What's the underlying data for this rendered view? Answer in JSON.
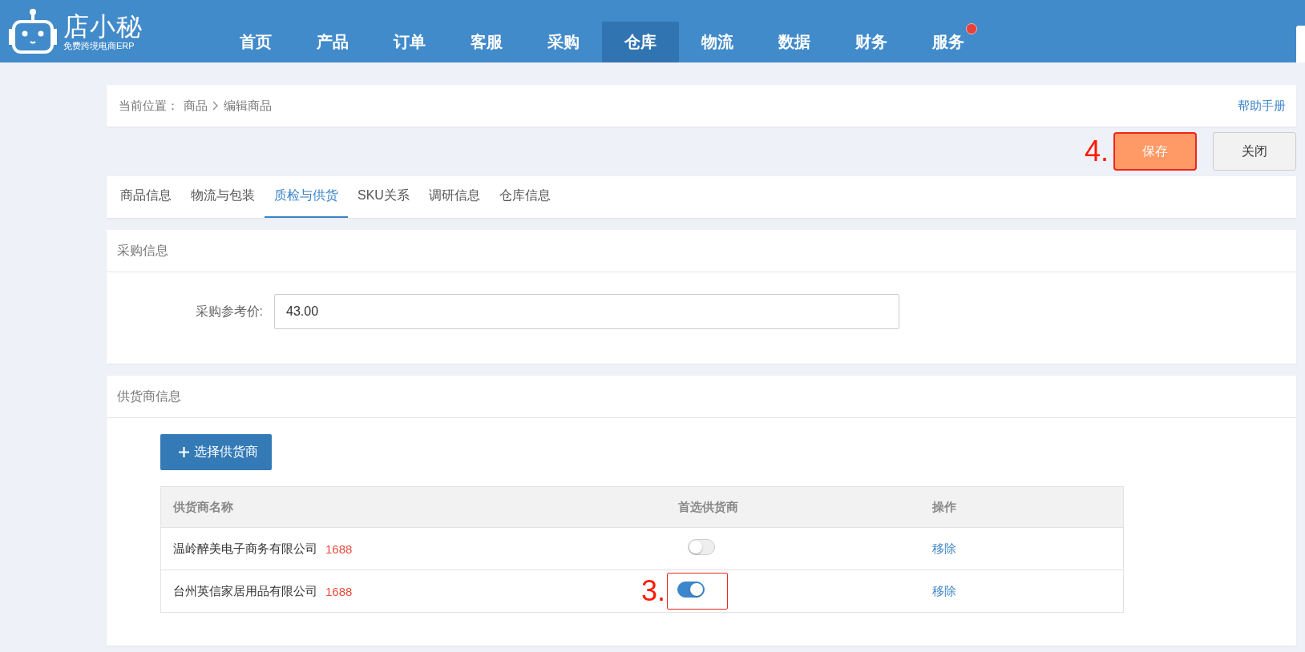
{
  "header": {
    "logo": {
      "name": "店小秘",
      "tagline": "免费跨境电商ERP"
    },
    "nav": [
      {
        "label": "首页",
        "selected": false,
        "notification": false
      },
      {
        "label": "产品",
        "selected": false,
        "notification": false
      },
      {
        "label": "订单",
        "selected": false,
        "notification": false
      },
      {
        "label": "客服",
        "selected": false,
        "notification": false
      },
      {
        "label": "采购",
        "selected": false,
        "notification": false
      },
      {
        "label": "仓库",
        "selected": true,
        "notification": false
      },
      {
        "label": "物流",
        "selected": false,
        "notification": false
      },
      {
        "label": "数据",
        "selected": false,
        "notification": false
      },
      {
        "label": "财务",
        "selected": false,
        "notification": false
      },
      {
        "label": "服务",
        "selected": false,
        "notification": true
      }
    ]
  },
  "breadcrumb": {
    "label": "当前位置：",
    "items": [
      "商品",
      "编辑商品"
    ],
    "help": "帮助手册"
  },
  "actions": [
    {
      "label": "保存",
      "kind": "primary",
      "annotation": "4."
    },
    {
      "label": "关闭",
      "kind": "default"
    }
  ],
  "tabs": [
    {
      "label": "商品信息",
      "selected": false
    },
    {
      "label": "物流与包装",
      "selected": false
    },
    {
      "label": "质检与供货",
      "selected": true
    },
    {
      "label": "SKU关系",
      "selected": false
    },
    {
      "label": "调研信息",
      "selected": false
    },
    {
      "label": "仓库信息",
      "selected": false
    }
  ],
  "purchase": {
    "title": "采购信息",
    "fields": [
      {
        "label": "采购参考价:",
        "value": "43.00"
      }
    ]
  },
  "supplier": {
    "title": "供货商信息",
    "add_button": "选择供货商",
    "table": {
      "columns": [
        "供货商名称",
        "首选供货商",
        "操作"
      ],
      "rows": [
        {
          "name": "温岭醉美电子商务有限公司",
          "platform": "1688",
          "preferred": false,
          "action": "移除"
        },
        {
          "name": "台州英信家居用品有限公司",
          "platform": "1688",
          "preferred": true,
          "action": "移除",
          "annotation": "3."
        }
      ]
    }
  }
}
